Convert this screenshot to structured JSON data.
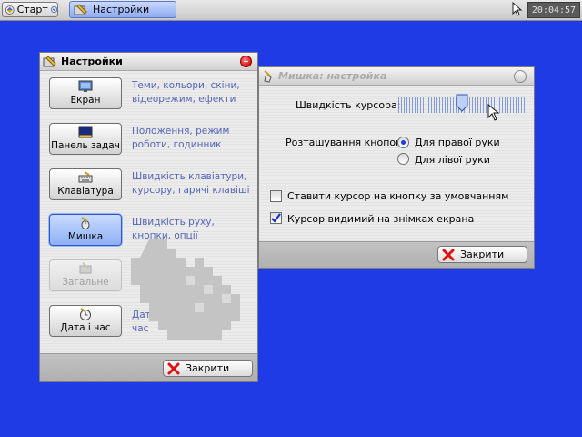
{
  "taskbar": {
    "start_label": "Старт",
    "task_label": "Настройки",
    "clock": "20:04:57"
  },
  "settings_window": {
    "title": "Настройки",
    "categories": [
      {
        "label": "Екран",
        "description": "Теми, кольори, скіни, відеорежим, ефекти",
        "icon": "monitor-icon"
      },
      {
        "label": "Панель задач",
        "description": "Положення, режим роботи, годинник",
        "icon": "taskbar-icon"
      },
      {
        "label": "Клавіатура",
        "description": "Швидкість клавіатури, курсору, гарячі клавіші",
        "icon": "keyboard-icon"
      },
      {
        "label": "Мишка",
        "description": "Швидкість руху, кнопки, опції",
        "icon": "mouse-icon"
      },
      {
        "label": "Загальне",
        "description": "",
        "icon": "general-icon"
      },
      {
        "label": "Дата і час",
        "description": "Дата, час",
        "icon": "clock-icon"
      }
    ],
    "close_label": "Закрити"
  },
  "mouse_window": {
    "title": "Мишка: настройка",
    "speed_label": "Швидкість курсора:",
    "speed_level": 0.5,
    "buttons_label": "Розташування кнопок:",
    "right_hand": "Для правої руки",
    "left_hand": "Для лівої руки",
    "snap_label": "Ставити курсор на кнопку за умовчанням",
    "visible_label": "Курсор видимий на знімках екрана",
    "close_label": "Закрити"
  },
  "colors": {
    "desktop": "#1f3be6",
    "link_text": "#5565b5",
    "close_red": "#d81010"
  }
}
